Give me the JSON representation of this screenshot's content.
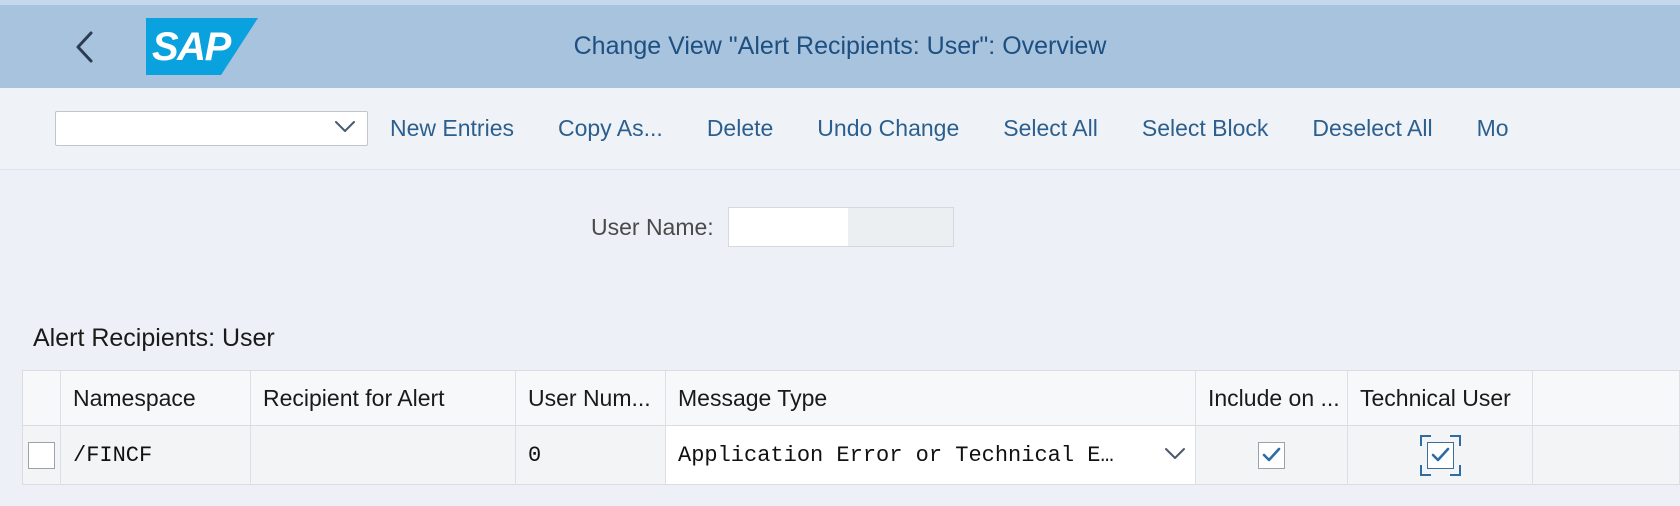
{
  "shell": {
    "back_icon": "chevron-left-icon",
    "logo_text": "SAP",
    "logo_color": "#0aa1df",
    "title": "Change View \"Alert Recipients: User\": Overview",
    "header_color": "#a8c3dd",
    "title_color": "#1d4f80"
  },
  "toolbar": {
    "combo_value": "",
    "combo_icon": "chevron-down-icon",
    "buttons": [
      {
        "label": "New Entries"
      },
      {
        "label": "Copy As..."
      },
      {
        "label": "Delete"
      },
      {
        "label": "Undo Change"
      },
      {
        "label": "Select All"
      },
      {
        "label": "Select Block"
      },
      {
        "label": "Deselect All"
      },
      {
        "label": "Mo"
      }
    ]
  },
  "filter": {
    "label": "User Name:",
    "value": "",
    "placeholder": ""
  },
  "section": {
    "title": "Alert Recipients: User"
  },
  "table": {
    "columns": [
      {
        "key": "select",
        "label": ""
      },
      {
        "key": "namespace",
        "label": "Namespace"
      },
      {
        "key": "recipient",
        "label": "Recipient for Alert"
      },
      {
        "key": "usernumber",
        "label": "User Num..."
      },
      {
        "key": "messagetype",
        "label": "Message Type"
      },
      {
        "key": "include",
        "label": "Include on ..."
      },
      {
        "key": "technical",
        "label": "Technical User"
      }
    ],
    "rows": [
      {
        "selected": false,
        "namespace": "/FINCF",
        "recipient": "",
        "usernumber": "0",
        "messagetype": "Application Error or Technical E…",
        "messagetype_icon": "chevron-down-icon",
        "include": true,
        "technical": true,
        "technical_focused": true
      }
    ]
  }
}
